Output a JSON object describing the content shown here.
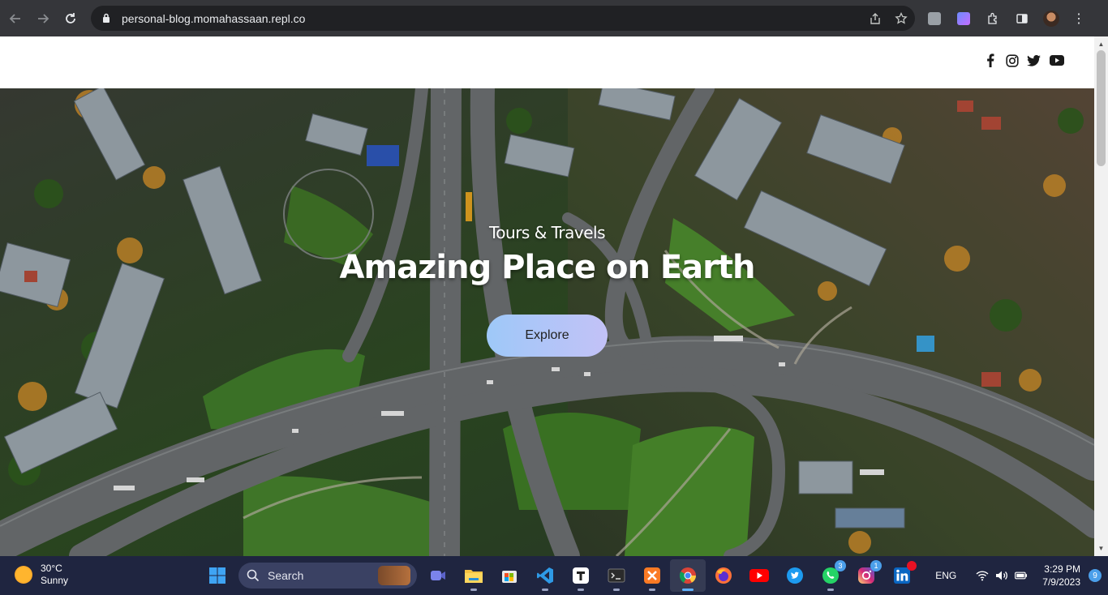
{
  "browser": {
    "url": "personal-blog.momahassaan.repl.co",
    "back_icon": "arrow-left-icon",
    "forward_icon": "arrow-right-icon",
    "reload_icon": "reload-icon"
  },
  "site": {
    "social": [
      "facebook-icon",
      "instagram-icon",
      "twitter-icon",
      "youtube-icon"
    ],
    "hero": {
      "subtitle": "Tours & Travels",
      "title": "Amazing Place on Earth",
      "button": "Explore"
    },
    "colors": {
      "button_from": "#9ec8f8",
      "button_to": "#c3c2f7"
    }
  },
  "taskbar": {
    "weather_temp": "30°C",
    "weather_cond": "Sunny",
    "search_label": "Search",
    "apps": [
      {
        "name": "start-icon"
      },
      {
        "name": "meet-icon"
      },
      {
        "name": "file-explorer-icon"
      },
      {
        "name": "store-icon"
      },
      {
        "name": "vscode-icon"
      },
      {
        "name": "typora-icon"
      },
      {
        "name": "terminal-icon"
      },
      {
        "name": "xampp-icon"
      },
      {
        "name": "chrome-icon"
      },
      {
        "name": "firefox-icon"
      },
      {
        "name": "youtube-app-icon"
      },
      {
        "name": "twitter-app-icon"
      },
      {
        "name": "whatsapp-icon",
        "badge": "3"
      },
      {
        "name": "instagram-app-icon",
        "badge": "1"
      },
      {
        "name": "linkedin-icon"
      }
    ],
    "lang": "ENG",
    "time": "3:29 PM",
    "date": "7/9/2023",
    "notifications": "9"
  }
}
